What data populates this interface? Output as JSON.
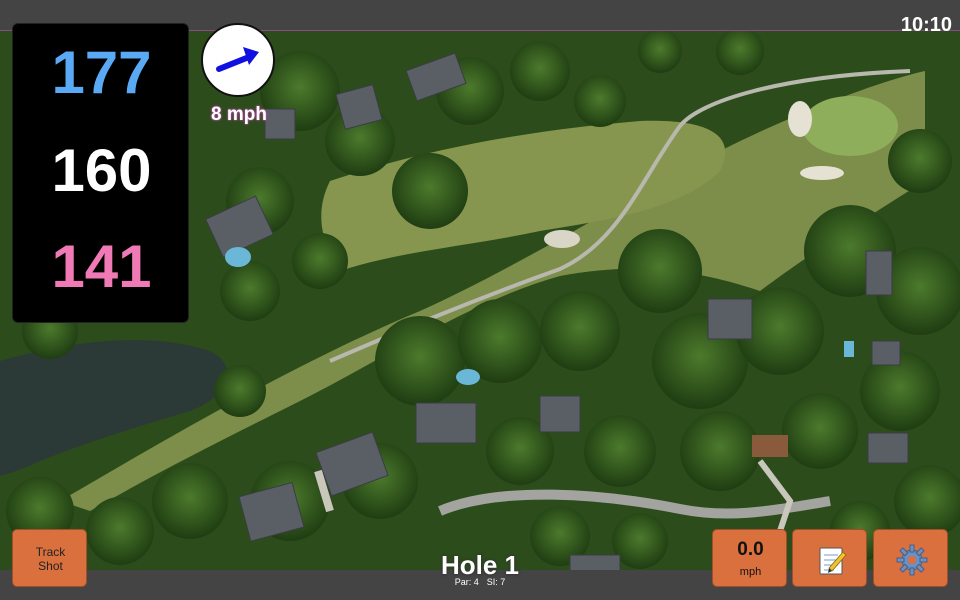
{
  "status": {
    "time": "10:10"
  },
  "distances": {
    "back": "177",
    "center": "160",
    "front": "141"
  },
  "wind": {
    "speed": "8 mph",
    "direction_icon": "arrow-northeast-icon"
  },
  "buttons": {
    "track_shot": {
      "line1": "Track",
      "line2": "Shot"
    },
    "speed": {
      "value": "0.0",
      "unit": "mph"
    },
    "notes_icon": "notepad-icon",
    "settings_icon": "gear-icon"
  },
  "hole": {
    "title": "Hole 1",
    "par": "Par: 4",
    "si": "SI: 7"
  },
  "colors": {
    "back": "#5aa9f5",
    "center": "#ffffff",
    "front": "#f07ab6",
    "button": "#d9703d",
    "wind_label_outline": "#b04aa0"
  }
}
